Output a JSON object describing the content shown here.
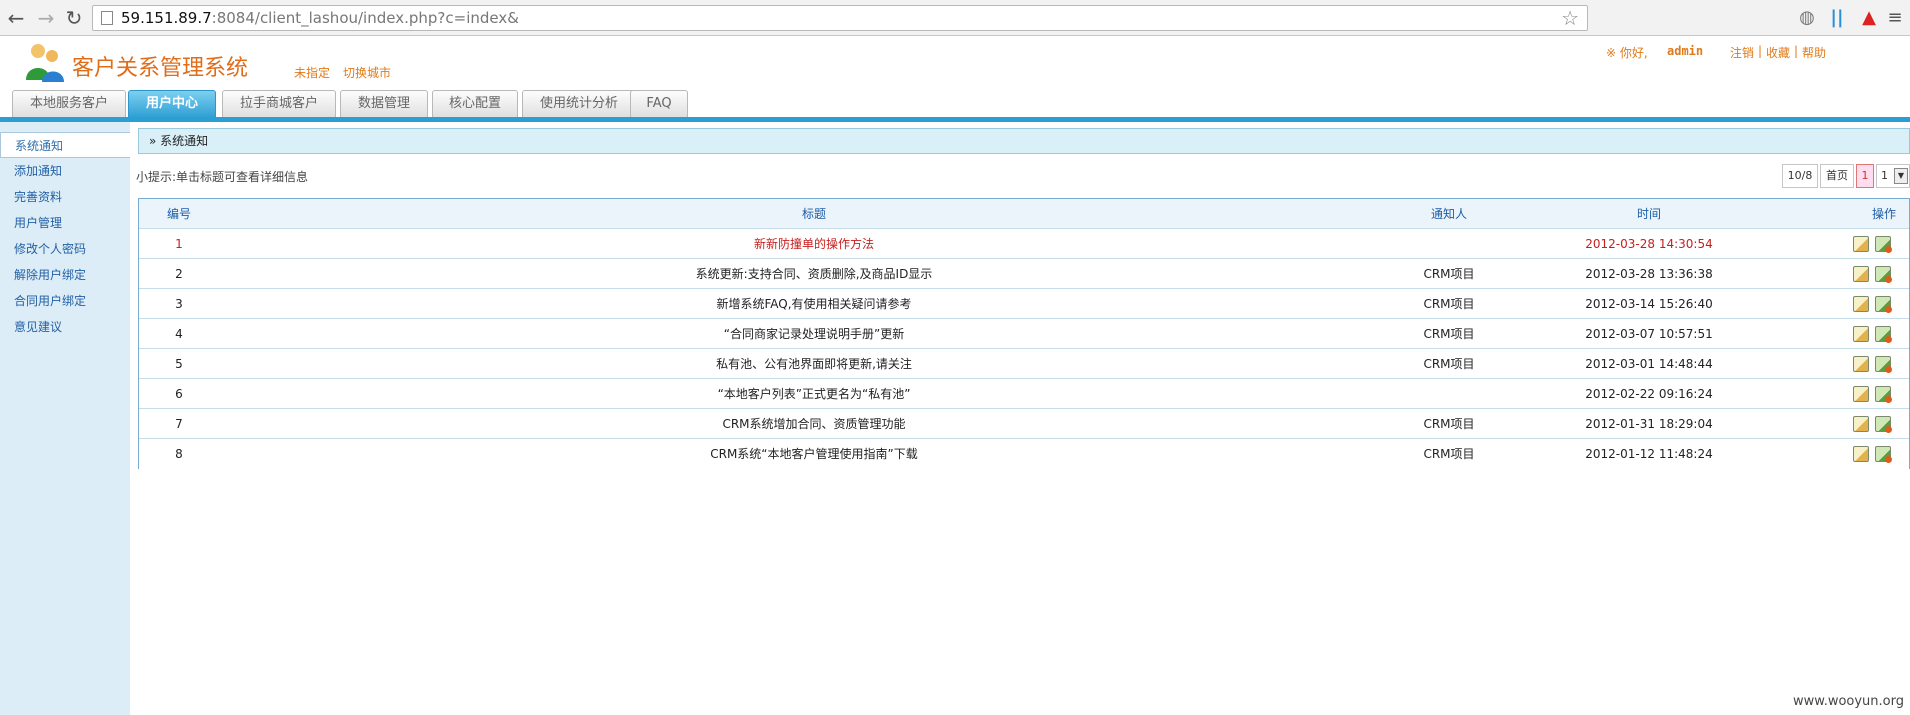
{
  "browser": {
    "url_host": "59.151.89.7",
    "url_rest": ":8084/client_lashou/index.php?c=index&"
  },
  "app": {
    "title": "客户关系管理系统",
    "city_current": "未指定",
    "city_switch": "切换城市",
    "greeting": "※ 你好,",
    "username": "admin",
    "logout": "注销",
    "favorite": "收藏",
    "help": "帮助"
  },
  "tabs": [
    {
      "label": "本地服务客户"
    },
    {
      "label": "用户中心"
    },
    {
      "label": "拉手商城客户"
    },
    {
      "label": "数据管理"
    },
    {
      "label": "核心配置"
    },
    {
      "label": "使用统计分析"
    },
    {
      "label": "FAQ"
    }
  ],
  "sidebar": [
    {
      "label": "系统通知"
    },
    {
      "label": "添加通知"
    },
    {
      "label": "完善资料"
    },
    {
      "label": "用户管理"
    },
    {
      "label": "修改个人密码"
    },
    {
      "label": "解除用户绑定"
    },
    {
      "label": "合同用户绑定"
    },
    {
      "label": "意见建议"
    }
  ],
  "breadcrumb": "» 系统通知",
  "hint": "小提示:单击标题可查看详细信息",
  "pager": {
    "count": "10/8",
    "first": "首页",
    "current": "1",
    "select_value": "1"
  },
  "table": {
    "headers": [
      "编号",
      "标题",
      "通知人",
      "时间",
      "操作"
    ],
    "rows": [
      {
        "id": "1",
        "title": "新新防撞单的操作方法",
        "author": "",
        "time": "2012-03-28 14:30:54"
      },
      {
        "id": "2",
        "title": "系统更新:支持合同、资质删除,及商品ID显示",
        "author": "CRM项目",
        "time": "2012-03-28 13:36:38"
      },
      {
        "id": "3",
        "title": "新增系统FAQ,有使用相关疑问请参考",
        "author": "CRM项目",
        "time": "2012-03-14 15:26:40"
      },
      {
        "id": "4",
        "title": "“合同商家记录处理说明手册”更新",
        "author": "CRM项目",
        "time": "2012-03-07 10:57:51"
      },
      {
        "id": "5",
        "title": "私有池、公有池界面即将更新,请关注",
        "author": "CRM项目",
        "time": "2012-03-01 14:48:44"
      },
      {
        "id": "6",
        "title": "“本地客户列表”正式更名为“私有池”",
        "author": "",
        "time": "2012-02-22 09:16:24"
      },
      {
        "id": "7",
        "title": "CRM系统增加合同、资质管理功能",
        "author": "CRM项目",
        "time": "2012-01-31 18:29:04"
      },
      {
        "id": "8",
        "title": "CRM系统“本地客户管理使用指南”下载",
        "author": "CRM项目",
        "time": "2012-01-12 11:48:24"
      }
    ]
  },
  "watermark": "www.wooyun.org"
}
